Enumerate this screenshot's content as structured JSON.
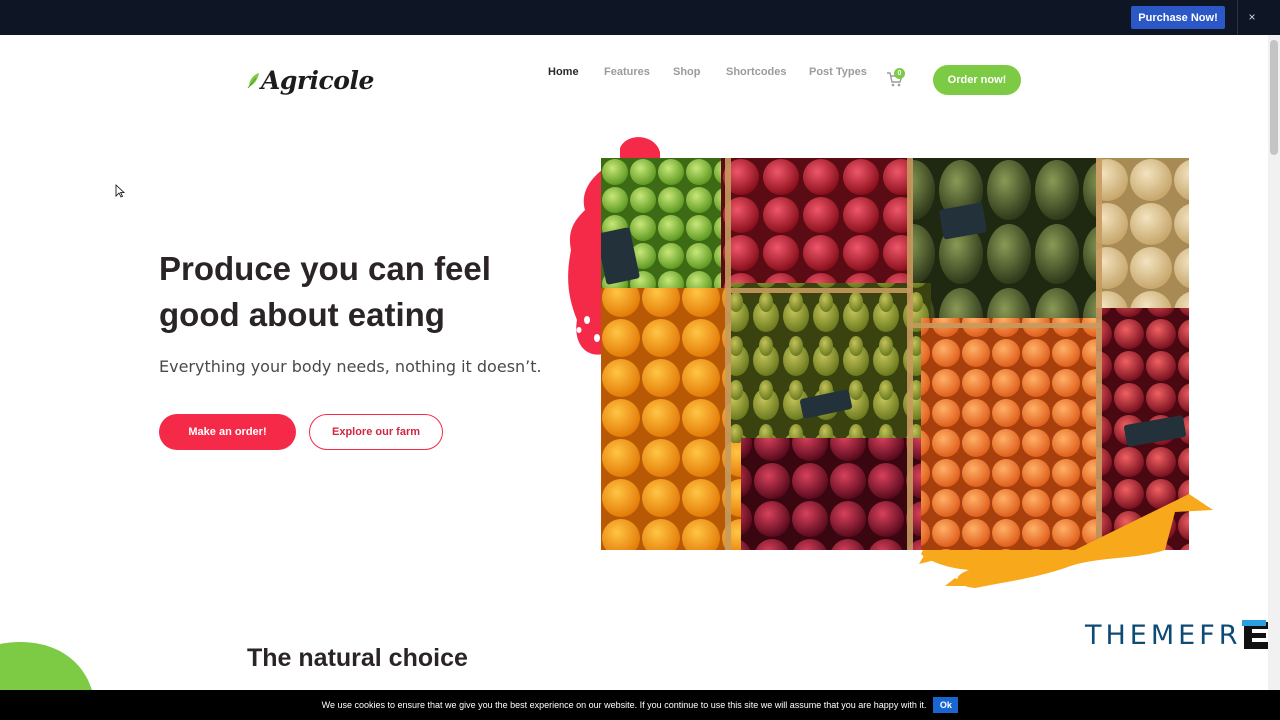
{
  "topbar": {
    "purchase_label": "Purchase Now!",
    "close_label": "×"
  },
  "header": {
    "logo_text": "Agricole",
    "nav": {
      "home": "Home",
      "features": "Features",
      "shop": "Shop",
      "shortcodes": "Shortcodes",
      "post_types": "Post Types"
    },
    "cart_count": "0",
    "order_now": "Order now!"
  },
  "hero": {
    "title": "Produce you can feel good about eating",
    "subtitle": "Everything your body needs, nothing it doesn’t.",
    "primary_button": "Make an order!",
    "secondary_button": "Explore our farm"
  },
  "section": {
    "title": "The natural choice"
  },
  "watermark": {
    "text_main": "THEMEFR",
    "text_e": "E"
  },
  "cookie": {
    "text": "We use cookies to ensure that we give you the best experience on our website. If you continue to use this site we will assume that you are happy with it.",
    "ok": "Ok"
  },
  "colors": {
    "accent_red": "#f52a49",
    "accent_green": "#7dcb45",
    "topbar_bg": "#0e1525",
    "purchase_blue": "#2b58c6",
    "accent_yellow": "#f7a81b"
  },
  "icons": [
    "leaf-icon",
    "cart-icon",
    "close-icon",
    "cursor-icon"
  ]
}
